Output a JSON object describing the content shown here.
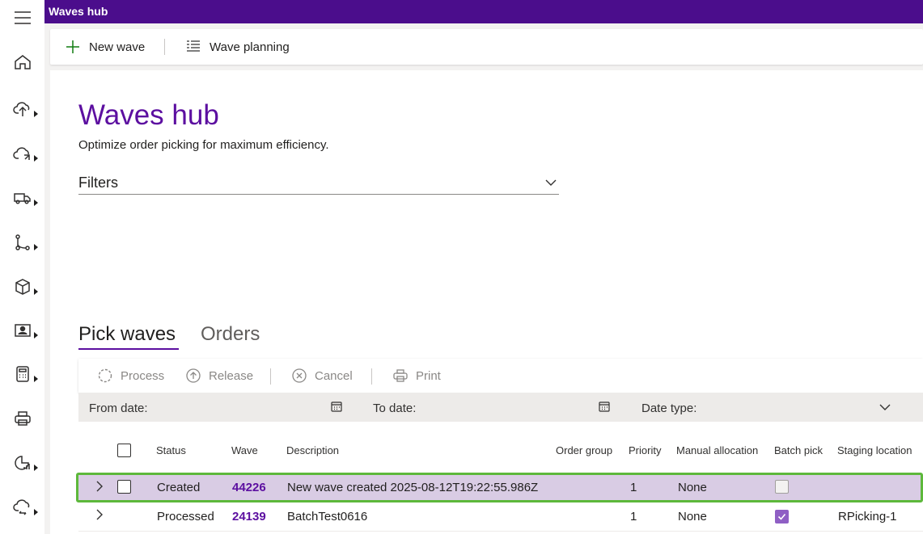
{
  "app": {
    "title": "Waves hub"
  },
  "nav": {
    "icons": [
      "hamburger-icon",
      "home-icon",
      "upload-icon",
      "cloud-sync-icon",
      "truck-icon",
      "flow-icon",
      "box-icon",
      "contact-card-icon",
      "calculator-icon",
      "printer-icon",
      "chart-icon",
      "cloud-exchange-icon"
    ]
  },
  "actions": {
    "new_wave": "New wave",
    "wave_planning": "Wave planning"
  },
  "page": {
    "title": "Waves hub",
    "subtitle": "Optimize order picking for maximum efficiency.",
    "filters_label": "Filters"
  },
  "tabs": [
    {
      "label": "Pick waves",
      "active": true
    },
    {
      "label": "Orders",
      "active": false
    }
  ],
  "grid_toolbar": {
    "process": "Process",
    "release": "Release",
    "cancel": "Cancel",
    "print": "Print"
  },
  "filter_strip": {
    "from_date": "From date:",
    "to_date": "To date:",
    "date_type": "Date type:"
  },
  "columns": {
    "status": "Status",
    "wave": "Wave",
    "description": "Description",
    "order_group": "Order group",
    "priority": "Priority",
    "manual_allocation": "Manual allocation",
    "batch_pick": "Batch pick",
    "staging_location": "Staging location"
  },
  "rows": [
    {
      "status": "Created",
      "wave": "44226",
      "description": "New wave created 2025-08-12T19:22:55.986Z",
      "order_group": "",
      "priority": "1",
      "manual_allocation": "None",
      "batch_pick": false,
      "staging_location": ""
    },
    {
      "status": "Processed",
      "wave": "24139",
      "description": "BatchTest0616",
      "order_group": "",
      "priority": "1",
      "manual_allocation": "None",
      "batch_pick": true,
      "staging_location": "RPicking-1"
    }
  ],
  "colors": {
    "brand": "#4b0d8c",
    "accent": "#5c0fa0",
    "selected_row": "#d9cce4",
    "highlight_border": "#5db83b"
  }
}
